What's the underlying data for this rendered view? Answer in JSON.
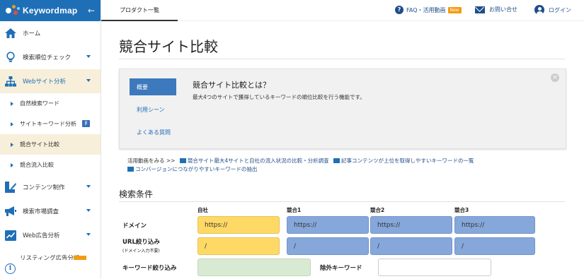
{
  "app": {
    "logo_text": "Keywordmap",
    "collapse_icon": "arrow-left-icon"
  },
  "sidebar": {
    "items": [
      {
        "label": "ホーム",
        "icon": "home-icon"
      },
      {
        "label": "検索順位チェック",
        "icon": "lightbulb-icon"
      },
      {
        "label": "Webサイト分析",
        "icon": "sitemap-icon"
      },
      {
        "label": "コンテンツ制作",
        "icon": "content-edit-icon"
      },
      {
        "label": "検索市場調査",
        "icon": "megaphone-icon"
      },
      {
        "label": "Web広告分析",
        "icon": "line-chart-icon"
      },
      {
        "label": "リスティング広告分析"
      }
    ],
    "subitems": [
      {
        "label": "自然検索ワード"
      },
      {
        "label": "サイトキーワード分析",
        "badge": "β"
      },
      {
        "label": "競合サイト比較"
      },
      {
        "label": "競合流入比較"
      }
    ]
  },
  "header": {
    "tab": "プロダクト一覧",
    "faq": "FAQ・活用動画",
    "new_badge": "New",
    "contact": "お問い合せ",
    "login": "ログイン"
  },
  "page": {
    "title": "競合サイト比較",
    "card": {
      "tabs": [
        "概要",
        "利用シーン",
        "よくある質問"
      ],
      "heading": "競合サイト比較とは？",
      "description": "最大4つのサイトで獲得しているキーワードの順位比較を行う機能です。",
      "close": "×"
    },
    "video_links": {
      "prefix": "活用動画をみる >>",
      "links": [
        "競合サイト最大4サイトと自社の流入状況の比較・分析調査",
        "記事コンテンツが上位を取得しやすいキーワードの一覧",
        "コンバージョンにつながりやすいキーワードの抽出"
      ]
    },
    "search": {
      "title": "検索条件",
      "columns": [
        "自社",
        "競合1",
        "競合2",
        "競合3"
      ],
      "domain_label": "ドメイン",
      "url_label": "URL絞り込み",
      "url_sub": "(ドメイン入力不要)",
      "domain_values": [
        "https://",
        "https://",
        "https://",
        "https://"
      ],
      "url_values": [
        "/",
        "/",
        "/",
        "/"
      ],
      "keyword_label": "キーワード絞り込み",
      "exclude_label": "除外キーワード",
      "keyword_value": "",
      "exclude_value": ""
    }
  },
  "colors": {
    "brand": "#1f6fb7",
    "active_bg": "#f7efd9",
    "own_field": "#ffd966",
    "competitor_field": "#86a7da",
    "keyword_field": "#d9ead3",
    "new_badge": "#f39c12"
  }
}
